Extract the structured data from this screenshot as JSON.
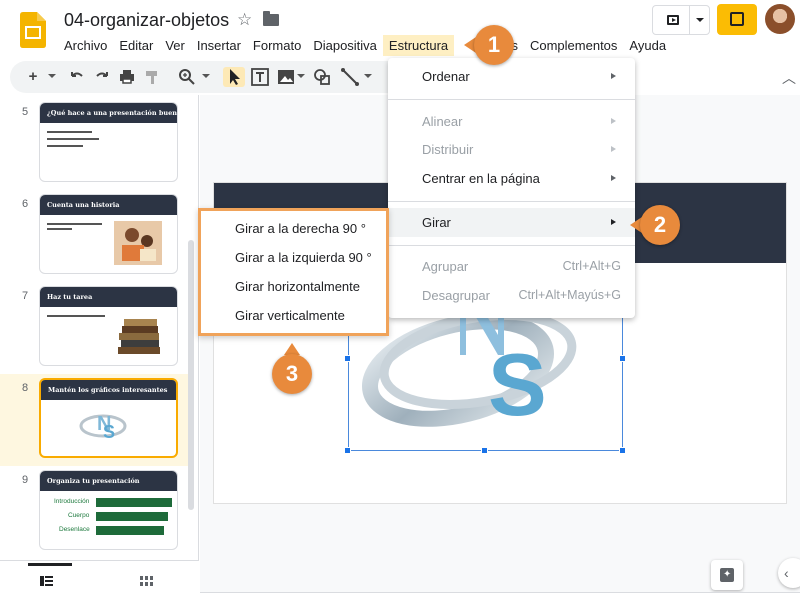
{
  "app": {
    "document_title": "04-organizar-objetos"
  },
  "menubar": {
    "items": [
      "Archivo",
      "Editar",
      "Ver",
      "Insertar",
      "Formato",
      "Diapositiva",
      "Estructura",
      "Herramientas",
      "Complementos",
      "Ayuda"
    ],
    "visible_labels": [
      "Archivo",
      "Editar",
      "Ver",
      "Insertar",
      "Formato",
      "Diapositiva",
      "Estructura",
      "",
      "entas",
      "Complementos",
      "Ayuda"
    ],
    "active": "Estructura"
  },
  "toolbar": {
    "icons": [
      "add-icon",
      "undo-icon",
      "redo-icon",
      "print-icon",
      "paint-format-icon",
      "zoom-icon",
      "select-cursor-icon",
      "textbox-icon",
      "image-icon",
      "shape-icon",
      "line-icon"
    ],
    "active_tool": "select-cursor-icon"
  },
  "filmstrip": {
    "slides": [
      {
        "number": "5",
        "title": "¿Qué hace a una presentación buena?"
      },
      {
        "number": "6",
        "title": "Cuenta una historia"
      },
      {
        "number": "7",
        "title": "Haz tu tarea"
      },
      {
        "number": "8",
        "title": "Mantén los gráficos interesantes",
        "selected": true
      },
      {
        "number": "9",
        "title": "Organiza tu presentación",
        "items": [
          "Introducción",
          "Cuerpo",
          "Desenlace"
        ]
      }
    ]
  },
  "structure_menu": {
    "items": [
      {
        "label": "Ordenar",
        "enabled": true,
        "submenu": true
      },
      {
        "label": "Alinear",
        "enabled": false,
        "submenu": true
      },
      {
        "label": "Distribuir",
        "enabled": false,
        "submenu": true
      },
      {
        "label": "Centrar en la página",
        "enabled": true,
        "submenu": true
      },
      {
        "label": "Girar",
        "enabled": true,
        "submenu": true,
        "highlighted": true
      },
      {
        "label": "Agrupar",
        "enabled": false,
        "shortcut": "Ctrl+Alt+G"
      },
      {
        "label": "Desagrupar",
        "enabled": false,
        "shortcut": "Ctrl+Alt+Mayús+G"
      }
    ]
  },
  "rotate_submenu": {
    "items": [
      "Girar a la derecha 90 °",
      "Girar a la izquierda 90 °",
      "Girar horizontalmente",
      "Girar verticalmente"
    ]
  },
  "callouts": [
    "1",
    "2",
    "3"
  ],
  "colors": {
    "accent": "#fbbc04",
    "callout": "#e88a3c",
    "slide_header": "#2c3444",
    "selection": "#1a73e8"
  }
}
